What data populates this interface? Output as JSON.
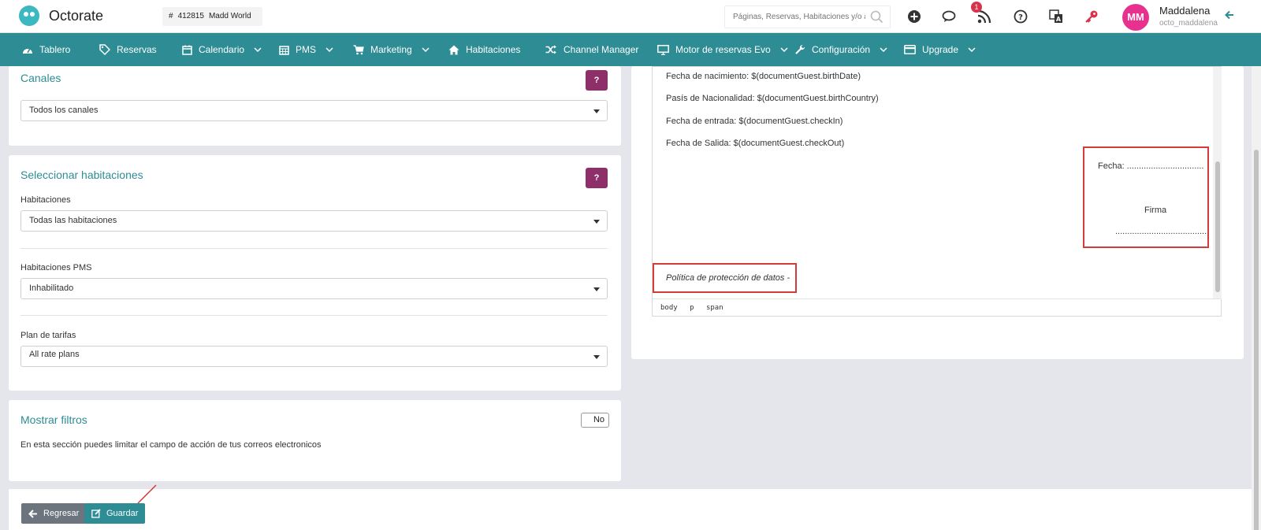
{
  "app": {
    "name": "Octorate"
  },
  "property": {
    "id": "412815",
    "name": "Madd World"
  },
  "search": {
    "placeholder": "Páginas, Reservas, Habitaciones y/o ayuda"
  },
  "notifications": {
    "count": "1"
  },
  "user": {
    "initials": "MM",
    "name": "Maddalena",
    "username": "octo_maddalena"
  },
  "nav": [
    {
      "label": "Tablero",
      "icon": "dashboard-icon"
    },
    {
      "label": "Reservas",
      "icon": "tag-icon"
    },
    {
      "label": "Calendario",
      "icon": "calendar-icon",
      "dropdown": true
    },
    {
      "label": "PMS",
      "icon": "calendar-grid-icon",
      "dropdown": true
    },
    {
      "label": "Marketing",
      "icon": "cart-icon",
      "dropdown": true
    },
    {
      "label": "Habitaciones",
      "icon": "home-icon"
    },
    {
      "label": "Channel Manager",
      "icon": "shuffle-icon"
    },
    {
      "label": "Motor de reservas Evo",
      "icon": "monitor-icon",
      "dropdown": true
    },
    {
      "label": "Configuración",
      "icon": "wrench-icon",
      "dropdown": true
    },
    {
      "label": "Upgrade",
      "icon": "card-icon",
      "dropdown": true
    }
  ],
  "channels": {
    "title": "Canales",
    "help": "?",
    "value": "Todos los canales"
  },
  "rooms": {
    "title": "Seleccionar habitaciones",
    "help": "?",
    "rooms_label": "Habitaciones",
    "rooms_value": "Todas las habitaciones",
    "pms_label": "Habitaciones PMS",
    "pms_value": "Inhabilitado",
    "rate_label": "Plan de tarifas",
    "rate_value": "All rate plans"
  },
  "filters": {
    "title": "Mostrar filtros",
    "toggle": "No",
    "description": "En esta sección puedes limitar el campo de acción de tus correos electronicos"
  },
  "editor": {
    "lines": [
      "Fecha de nacimiento: $(documentGuest.birthDate)",
      "Pasís de Nacionalidad: $(documentGuest.birthCountry)",
      "Fecha de entrada: $(documentGuest.checkIn)",
      "Fecha de Salida: $(documentGuest.checkOut)"
    ],
    "date_line": "Fecha: ................................",
    "signature_label": "Firma",
    "signature_line": "......................................",
    "privacy": "Política de protección de datos -",
    "path": [
      "body",
      "p",
      "span"
    ]
  },
  "actions": {
    "back": "Regresar",
    "save": "Guardar"
  },
  "colors": {
    "primary": "#2d8c94",
    "help": "#8e2f6a",
    "highlight": "#d43c3c",
    "avatar": "#e8308f",
    "back": "#6c757d"
  }
}
